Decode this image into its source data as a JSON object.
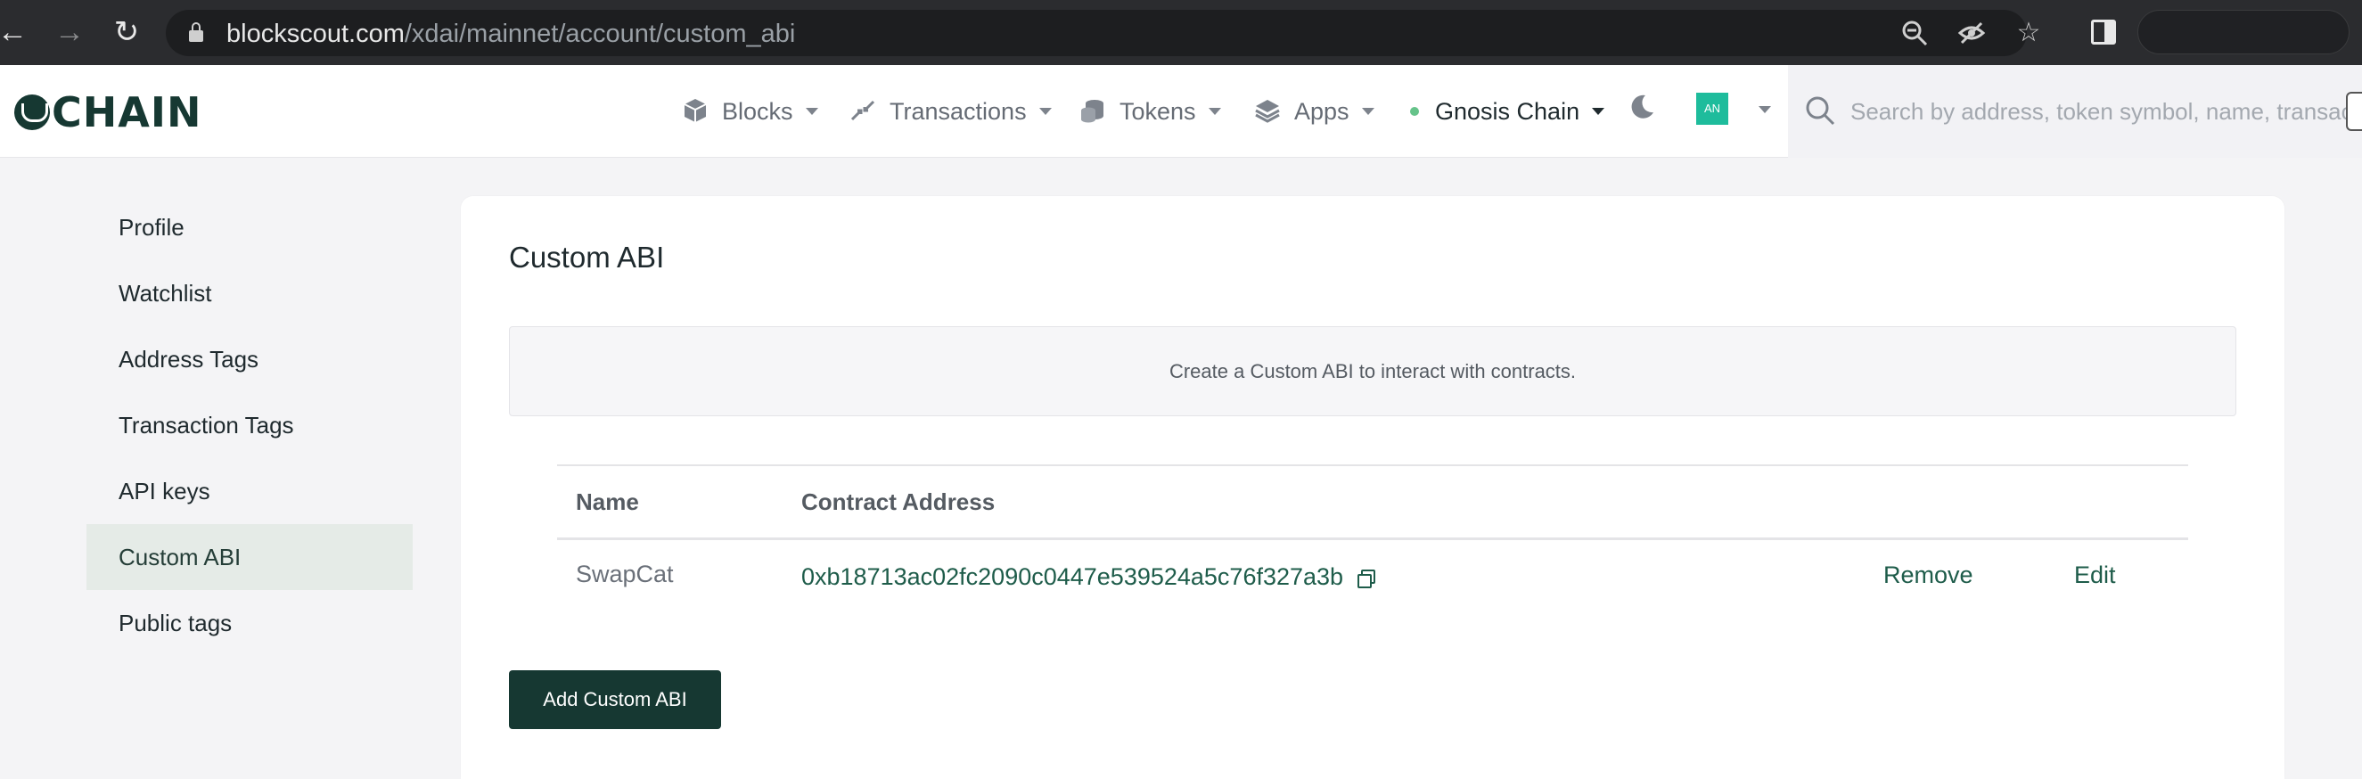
{
  "browser": {
    "url_domain": "blockscout.com",
    "url_path": "/xdai/mainnet/account/custom_abi",
    "back_icon": "arrow-left-icon",
    "forward_icon": "arrow-right-icon",
    "reload_icon": "reload-icon"
  },
  "header": {
    "logo_text": "CHAIN",
    "nav": [
      {
        "label": "Blocks",
        "icon": "cube-icon"
      },
      {
        "label": "Transactions",
        "icon": "arrows-icon"
      },
      {
        "label": "Tokens",
        "icon": "coins-icon"
      },
      {
        "label": "Apps",
        "icon": "layers-icon"
      }
    ],
    "network": "Gnosis Chain",
    "avatar": "AN",
    "search_placeholder": "Search by address, token symbol, name, transaction hash, or block number"
  },
  "sidebar": {
    "items": [
      {
        "label": "Profile"
      },
      {
        "label": "Watchlist"
      },
      {
        "label": "Address Tags"
      },
      {
        "label": "Transaction Tags"
      },
      {
        "label": "API keys"
      },
      {
        "label": "Custom ABI"
      },
      {
        "label": "Public tags"
      }
    ],
    "active": "Custom ABI"
  },
  "main": {
    "title": "Custom ABI",
    "info": "Create a Custom ABI to interact with contracts.",
    "table": {
      "headers": [
        "Name",
        "Contract Address"
      ],
      "rows": [
        {
          "name": "SwapCat",
          "address": "0xb18713ac02fc2090c0447e539524a5c76f327a3b",
          "remove_label": "Remove",
          "edit_label": "Edit"
        }
      ]
    },
    "add_button": "Add Custom ABI"
  },
  "colors": {
    "brand": "#163832",
    "link": "#1e5c4a",
    "active_bg": "#e5ebe7",
    "avatar_bg": "#1ebc9c"
  }
}
